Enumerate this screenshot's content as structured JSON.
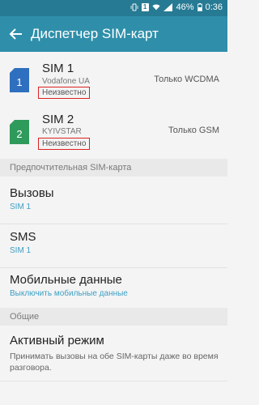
{
  "statusbar": {
    "sim_label": "1",
    "battery": "46%",
    "time": "0:36"
  },
  "appbar": {
    "title": "Диспетчер SIM-карт"
  },
  "sims": [
    {
      "card_number": "1",
      "card_color": "#2f6fbf",
      "name": "SIM 1",
      "operator": "Vodafone UA",
      "status": "Неизвестно",
      "mode": "Только WCDMA"
    },
    {
      "card_number": "2",
      "card_color": "#2e9a5c",
      "name": "SIM 2",
      "operator": "KYIVSTAR",
      "status": "Неизвестно",
      "mode": "Только GSM"
    }
  ],
  "sections": {
    "preferred": "Предпочтительная SIM-карта",
    "general": "Общие"
  },
  "preferred": {
    "calls": {
      "title": "Вызовы",
      "value": "SIM 1"
    },
    "sms": {
      "title": "SMS",
      "value": "SIM 1"
    },
    "data": {
      "title": "Мобильные данные",
      "value": "Выключить мобильные данные"
    }
  },
  "general": {
    "active_mode": {
      "title": "Активный режим",
      "description": "Принимать вызовы на обе SIM-карты даже во время разговора."
    }
  },
  "colors": {
    "statusbar": "#267a94",
    "appbar": "#2f8faa",
    "accent": "#3d9fc4",
    "highlight_border": "#dd2222"
  }
}
